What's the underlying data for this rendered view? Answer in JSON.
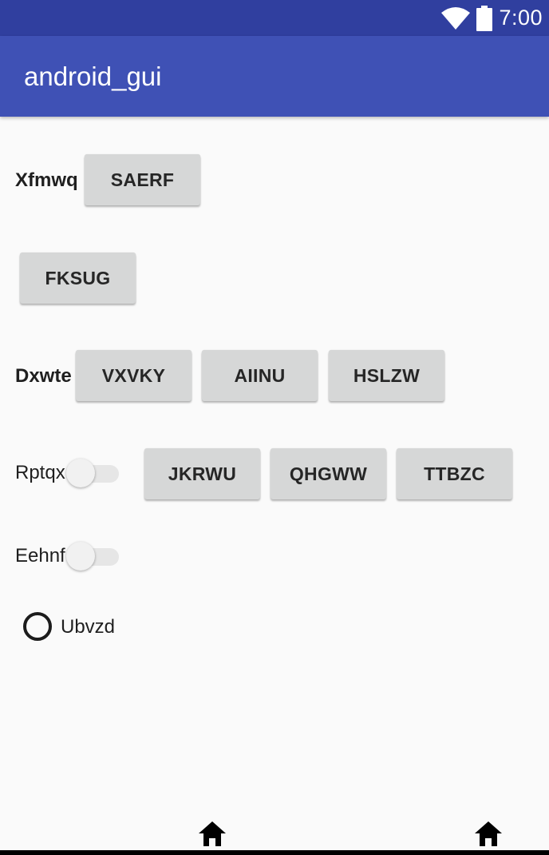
{
  "status_bar": {
    "time": "7:00",
    "icons": [
      "wifi-icon",
      "battery-icon"
    ]
  },
  "app_bar": {
    "title": "android_gui"
  },
  "rows": {
    "row1": {
      "label": "Xfmwq",
      "buttons": [
        "SAERF"
      ]
    },
    "row2": {
      "buttons": [
        "FKSUG"
      ]
    },
    "row3": {
      "label": "Dxwte",
      "buttons": [
        "VXVKY",
        "AIINU",
        "HSLZW"
      ]
    },
    "row4": {
      "label": "Rptqx",
      "switch_on": false,
      "buttons": [
        "JKRWU",
        "QHGWW",
        "TTBZC"
      ]
    },
    "row5": {
      "label": "Eehnf",
      "switch_on": false
    },
    "row6": {
      "radio_label": "Ubvzd",
      "radio_checked": false
    }
  },
  "nav_bar": {
    "icons": [
      "home-icon",
      "home-icon"
    ]
  },
  "colors": {
    "status_bar": "#303f9f",
    "app_bar": "#3f51b5",
    "background": "#fafafa",
    "button": "#d6d7d7"
  }
}
